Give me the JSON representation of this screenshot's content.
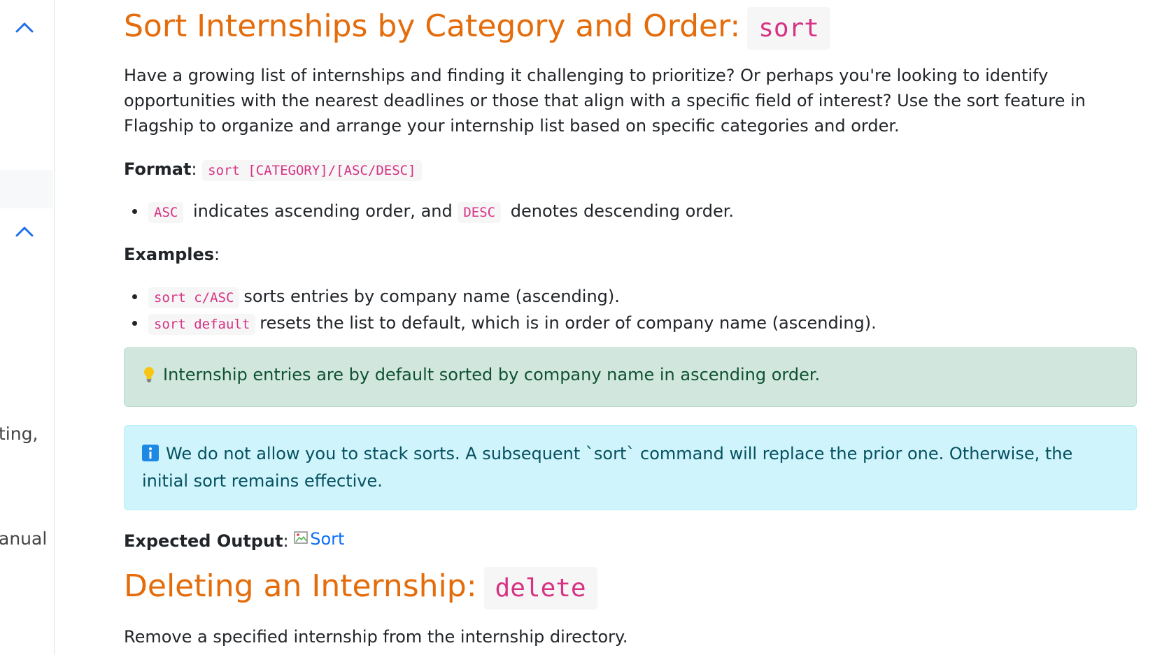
{
  "sidebar": {
    "partial_text_1": "ting,",
    "partial_text_2": "anual"
  },
  "sections": {
    "sort": {
      "title": "Sort Internships by Category and Order:",
      "command": "sort",
      "description": "Have a growing list of internships and finding it challenging to prioritize? Or perhaps you're looking to identify opportunities with the nearest deadlines or those that align with a specific field of interest? Use the sort feature in Flagship to organize and arrange your internship list based on specific categories and order.",
      "format_label": "Format",
      "format_code": "sort [CATEGORY]/[ASC/DESC]",
      "notes": [
        {
          "code": "ASC",
          "text1": " indicates ascending order, and ",
          "code2": "DESC",
          "text2": " denotes descending order."
        }
      ],
      "examples_label": "Examples",
      "examples": [
        {
          "code": "sort c/ASC",
          "text": "sorts entries by company name (ascending)."
        },
        {
          "code": "sort default",
          "text": "resets the list to default, which is in order of company name (ascending)."
        }
      ],
      "tip_text": "Internship entries are by default sorted by company name in ascending order.",
      "info_text": "We do not allow you to stack sorts. A subsequent `sort` command will replace the prior one. Otherwise, the initial sort remains effective.",
      "output_label": "Expected Output",
      "output_image_alt": "Sort"
    },
    "delete": {
      "title": "Deleting an Internship:",
      "command": "delete",
      "description": "Remove a specified internship from the internship directory."
    }
  },
  "colors": {
    "heading": "#e46c0a",
    "code": "#d63384",
    "link": "#0d6efd",
    "tip_bg": "#d1e7dd",
    "info_bg": "#cff4fc"
  },
  "icons": {
    "sidebar_toggle": "chevron-up-icon",
    "tip": "lightbulb-icon",
    "info": "info-icon",
    "broken_image": "broken-image-icon"
  }
}
